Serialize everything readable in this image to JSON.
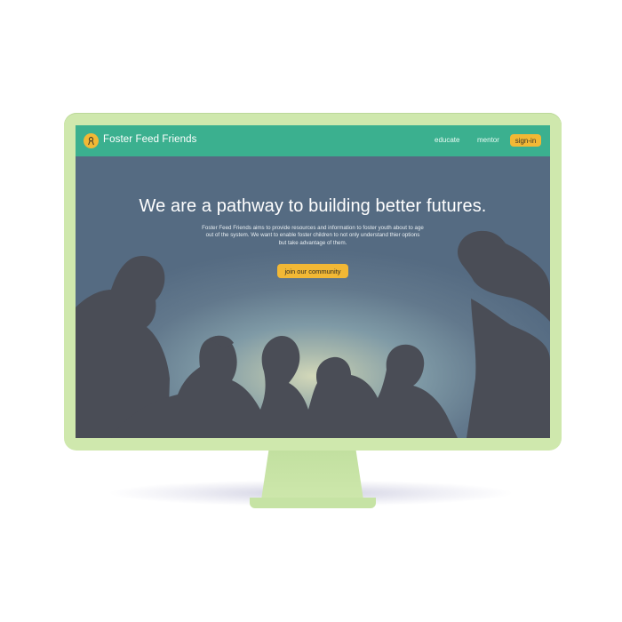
{
  "colors": {
    "monitor_bezel": "#cfe8ad",
    "navbar": "#3bb08f",
    "accent": "#f2b835",
    "silhouette": "#4a4d56"
  },
  "navbar": {
    "logo_icon": "ribbon-icon",
    "brand": "Foster Feed Friends",
    "links": [
      "educate",
      "mentor"
    ],
    "signin_label": "sign-in"
  },
  "hero": {
    "headline": "We are a pathway to building better futures.",
    "subtext": "Foster Feed Friends aims to provide resources and information to foster youth about to age out of the system. We want to enable foster children to not only understand thier options but take advantage of them.",
    "cta_label": "join our community"
  }
}
